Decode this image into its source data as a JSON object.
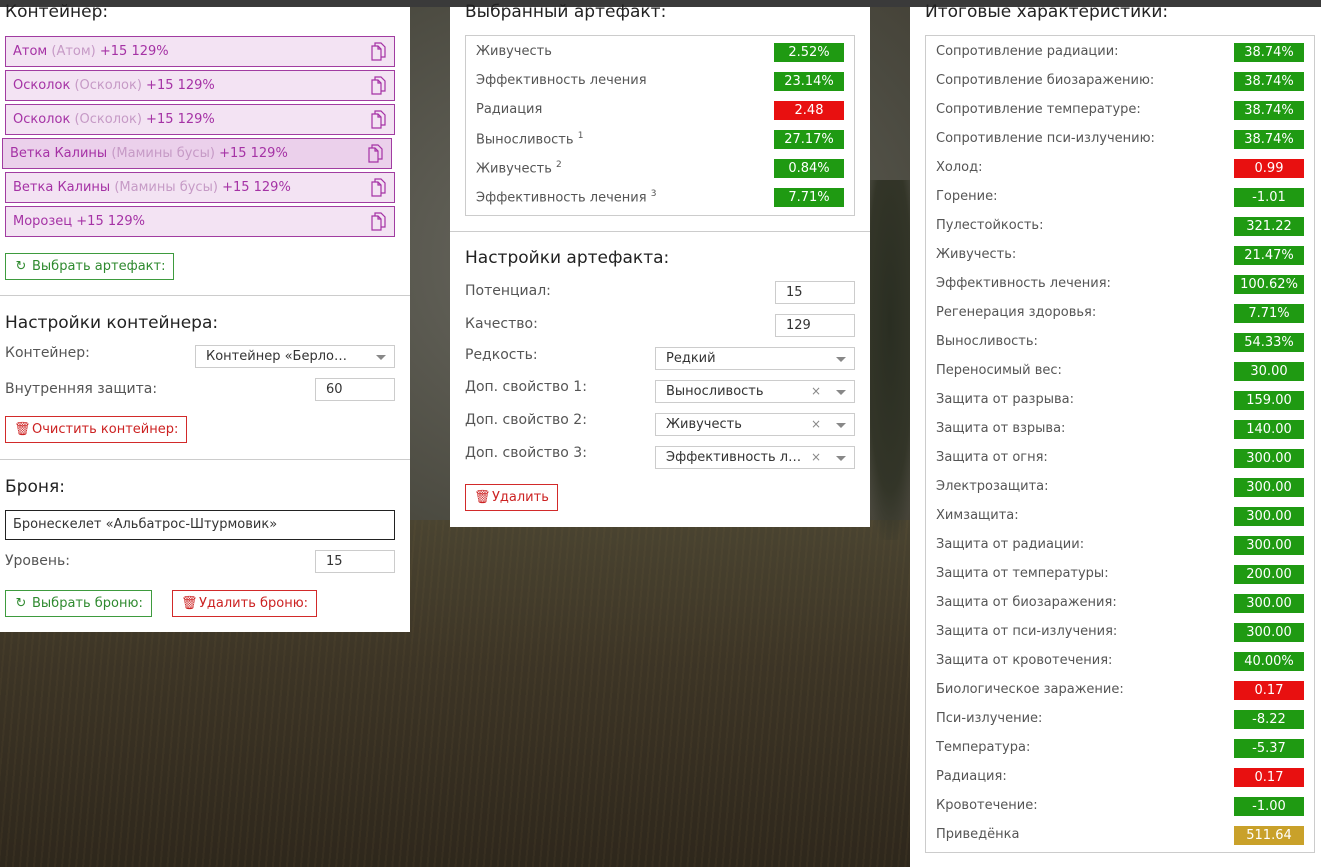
{
  "container": {
    "title": "Контейнер:",
    "items": [
      {
        "name": "Атом",
        "alt": "(Атом)",
        "bonus": "+15 129%"
      },
      {
        "name": "Осколок",
        "alt": "(Осколок)",
        "bonus": "+15 129%"
      },
      {
        "name": "Осколок",
        "alt": "(Осколок)",
        "bonus": "+15 129%"
      },
      {
        "name": "Ветка Калины",
        "alt": "(Мамины бусы)",
        "bonus": "+15 129%"
      },
      {
        "name": "Ветка Калины",
        "alt": "(Мамины бусы)",
        "bonus": "+15 129%"
      },
      {
        "name": "Морозец",
        "alt": "",
        "bonus": "+15 129%"
      }
    ],
    "select_artifact_label": "Выбрать артефакт:"
  },
  "container_settings": {
    "title": "Настройки контейнера:",
    "container_label": "Контейнер:",
    "container_value": "Контейнер «Берлога…",
    "protection_label": "Внутренняя защита:",
    "protection_value": "60",
    "clear_label": "Очистить контейнер:"
  },
  "armor": {
    "title": "Броня:",
    "name_value": "Бронескелет «Альбатрос-Штурмовик»",
    "level_label": "Уровень:",
    "level_value": "15",
    "select_label": "Выбрать броню:",
    "delete_label": "Удалить броню:"
  },
  "selected_artifact": {
    "title": "Выбранный артефакт:",
    "stats": [
      {
        "name": "Живучесть",
        "sup": "",
        "value": "2.52%",
        "color": "green"
      },
      {
        "name": "Эффективность лечения",
        "sup": "",
        "value": "23.14%",
        "color": "green"
      },
      {
        "name": "Радиация",
        "sup": "",
        "value": "2.48",
        "color": "red"
      },
      {
        "name": "Выносливость",
        "sup": "1",
        "value": "27.17%",
        "color": "green"
      },
      {
        "name": "Живучесть",
        "sup": "2",
        "value": "0.84%",
        "color": "green"
      },
      {
        "name": "Эффективность лечения",
        "sup": "3",
        "value": "7.71%",
        "color": "green"
      }
    ]
  },
  "artifact_settings": {
    "title": "Настройки артефакта:",
    "potential_label": "Потенциал:",
    "potential_value": "15",
    "quality_label": "Качество:",
    "quality_value": "129",
    "rarity_label": "Редкость:",
    "rarity_value": "Редкий",
    "prop1_label": "Доп. свойство 1:",
    "prop1_value": "Выносливость",
    "prop2_label": "Доп. свойство 2:",
    "prop2_value": "Живучесть",
    "prop3_label": "Доп. свойство 3:",
    "prop3_value": "Эффективность ле…",
    "clear_x": "×",
    "delete_label": "Удалить"
  },
  "totals": {
    "title": "Итоговые характеристики:",
    "stats": [
      {
        "name": "Сопротивление радиации:",
        "value": "38.74%",
        "color": "green"
      },
      {
        "name": "Сопротивление биозаражению:",
        "value": "38.74%",
        "color": "green"
      },
      {
        "name": "Сопротивление температуре:",
        "value": "38.74%",
        "color": "green"
      },
      {
        "name": "Сопротивление пси-излучению:",
        "value": "38.74%",
        "color": "green"
      },
      {
        "name": "Холод:",
        "value": "0.99",
        "color": "red"
      },
      {
        "name": "Горение:",
        "value": "-1.01",
        "color": "green"
      },
      {
        "name": "Пулестойкость:",
        "value": "321.22",
        "color": "green"
      },
      {
        "name": "Живучесть:",
        "value": "21.47%",
        "color": "green"
      },
      {
        "name": "Эффективность лечения:",
        "value": "100.62%",
        "color": "green"
      },
      {
        "name": "Регенерация здоровья:",
        "value": "7.71%",
        "color": "green"
      },
      {
        "name": "Выносливость:",
        "value": "54.33%",
        "color": "green"
      },
      {
        "name": "Переносимый вес:",
        "value": "30.00",
        "color": "green"
      },
      {
        "name": "Защита от разрыва:",
        "value": "159.00",
        "color": "green"
      },
      {
        "name": "Защита от взрыва:",
        "value": "140.00",
        "color": "green"
      },
      {
        "name": "Защита от огня:",
        "value": "300.00",
        "color": "green"
      },
      {
        "name": "Электрозащита:",
        "value": "300.00",
        "color": "green"
      },
      {
        "name": "Химзащита:",
        "value": "300.00",
        "color": "green"
      },
      {
        "name": "Защита от радиации:",
        "value": "300.00",
        "color": "green"
      },
      {
        "name": "Защита от температуры:",
        "value": "200.00",
        "color": "green"
      },
      {
        "name": "Защита от биозаражения:",
        "value": "300.00",
        "color": "green"
      },
      {
        "name": "Защита от пси-излучения:",
        "value": "300.00",
        "color": "green"
      },
      {
        "name": "Защита от кровотечения:",
        "value": "40.00%",
        "color": "green"
      },
      {
        "name": "Биологическое заражение:",
        "value": "0.17",
        "color": "red"
      },
      {
        "name": "Пси-излучение:",
        "value": "-8.22",
        "color": "green"
      },
      {
        "name": "Температура:",
        "value": "-5.37",
        "color": "green"
      },
      {
        "name": "Радиация:",
        "value": "0.17",
        "color": "red"
      },
      {
        "name": "Кровотечение:",
        "value": "-1.00",
        "color": "green"
      },
      {
        "name": "Приведёнка",
        "value": "511.64",
        "color": "gold"
      }
    ]
  }
}
